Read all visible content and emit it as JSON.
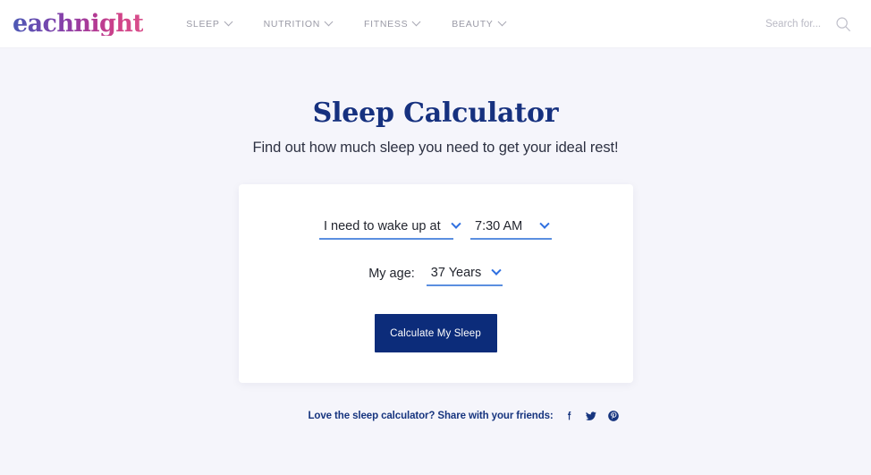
{
  "header": {
    "brand": "eachnight",
    "nav": [
      {
        "label": "SLEEP",
        "icon": "chevron-down-icon"
      },
      {
        "label": "NUTRITION",
        "icon": "chevron-down-icon"
      },
      {
        "label": "FITNESS",
        "icon": "chevron-down-icon"
      },
      {
        "label": "BEAUTY",
        "icon": "chevron-down-icon"
      }
    ],
    "search": {
      "placeholder": "Search for...",
      "value": "",
      "icon": "search-icon"
    }
  },
  "main": {
    "title": "Sleep Calculator",
    "subtitle": "Find out how much sleep you need to get your ideal rest!",
    "form": {
      "mode_select": {
        "value": "I need to wake up at",
        "icon": "chevron-down-icon"
      },
      "time_select": {
        "value": "7:30 AM",
        "icon": "chevron-down-icon"
      },
      "age_label": "My age:",
      "age_select": {
        "value": "37 Years",
        "icon": "chevron-down-icon"
      },
      "submit_label": "Calculate My Sleep"
    }
  },
  "share": {
    "prompt": "Love the sleep calculator? Share with your friends:",
    "networks": [
      {
        "name": "facebook-icon"
      },
      {
        "name": "twitter-icon"
      },
      {
        "name": "pinterest-icon"
      }
    ]
  },
  "colors": {
    "page_background": "#f5f5fb",
    "header_background": "#ffffff",
    "title_navy": "#16317f",
    "accent_blue": "#2f6fe0",
    "underline_blue": "#5b8fe0",
    "button_navy": "#0c2c7a",
    "nav_gray": "#9a9aa6",
    "brand_gradient_start": "#4a5bb5",
    "brand_gradient_end": "#d9508c"
  }
}
